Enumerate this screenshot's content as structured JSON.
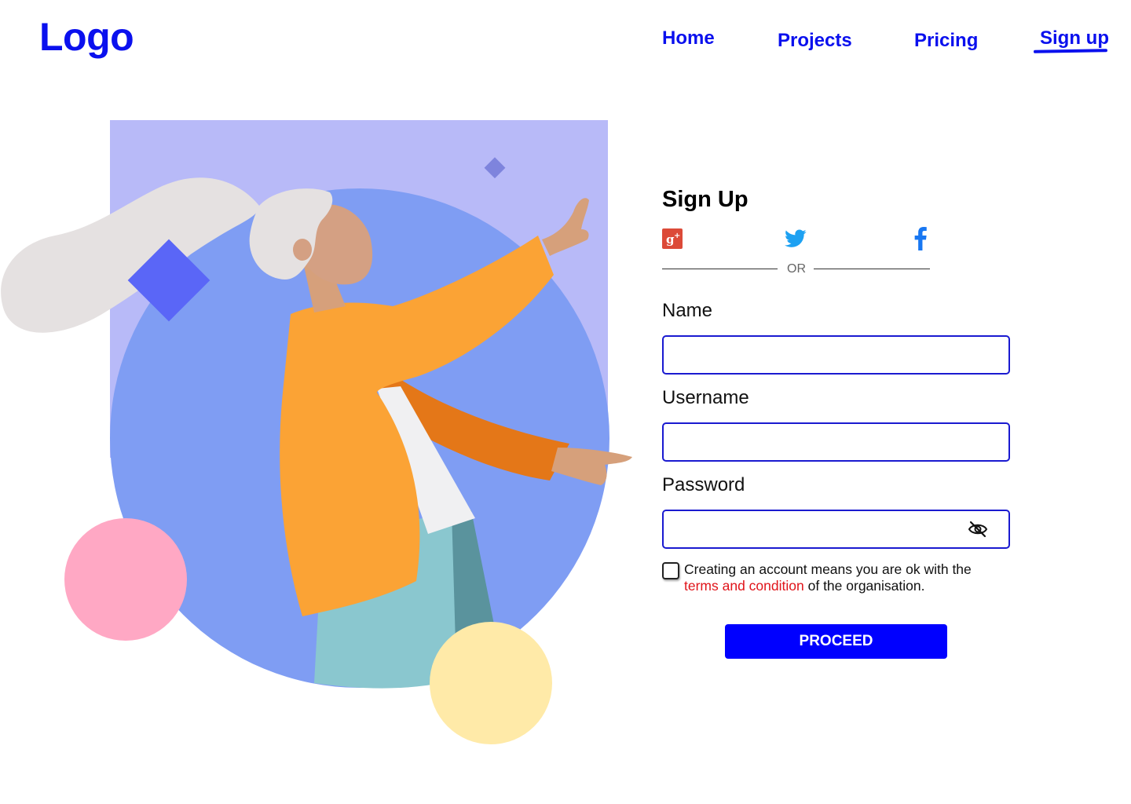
{
  "header": {
    "logo": "Logo",
    "nav": {
      "home": "Home",
      "projects": "Projects",
      "pricing": "Pricing",
      "signup": "Sign up"
    },
    "active_nav": "Sign up"
  },
  "illustration": {
    "description_icon": "woman-pointing-illustration"
  },
  "form": {
    "title": "Sign Up",
    "social": [
      "google-plus-icon",
      "twitter-icon",
      "facebook-icon"
    ],
    "divider": "OR",
    "fields": {
      "name": {
        "label": "Name",
        "value": ""
      },
      "username": {
        "label": "Username",
        "value": ""
      },
      "password": {
        "label": "Password",
        "value": ""
      }
    },
    "terms": {
      "prefix": "Creating an account means you are ok with the",
      "link": "terms and condition",
      "suffix": "of the organisation.",
      "checked": false
    },
    "proceed_label": "PROCEED"
  },
  "colors": {
    "brand_blue": "#0a10ee",
    "button_blue": "#0000ff",
    "link_red": "#e0141a",
    "input_border": "#1a1ad0"
  }
}
